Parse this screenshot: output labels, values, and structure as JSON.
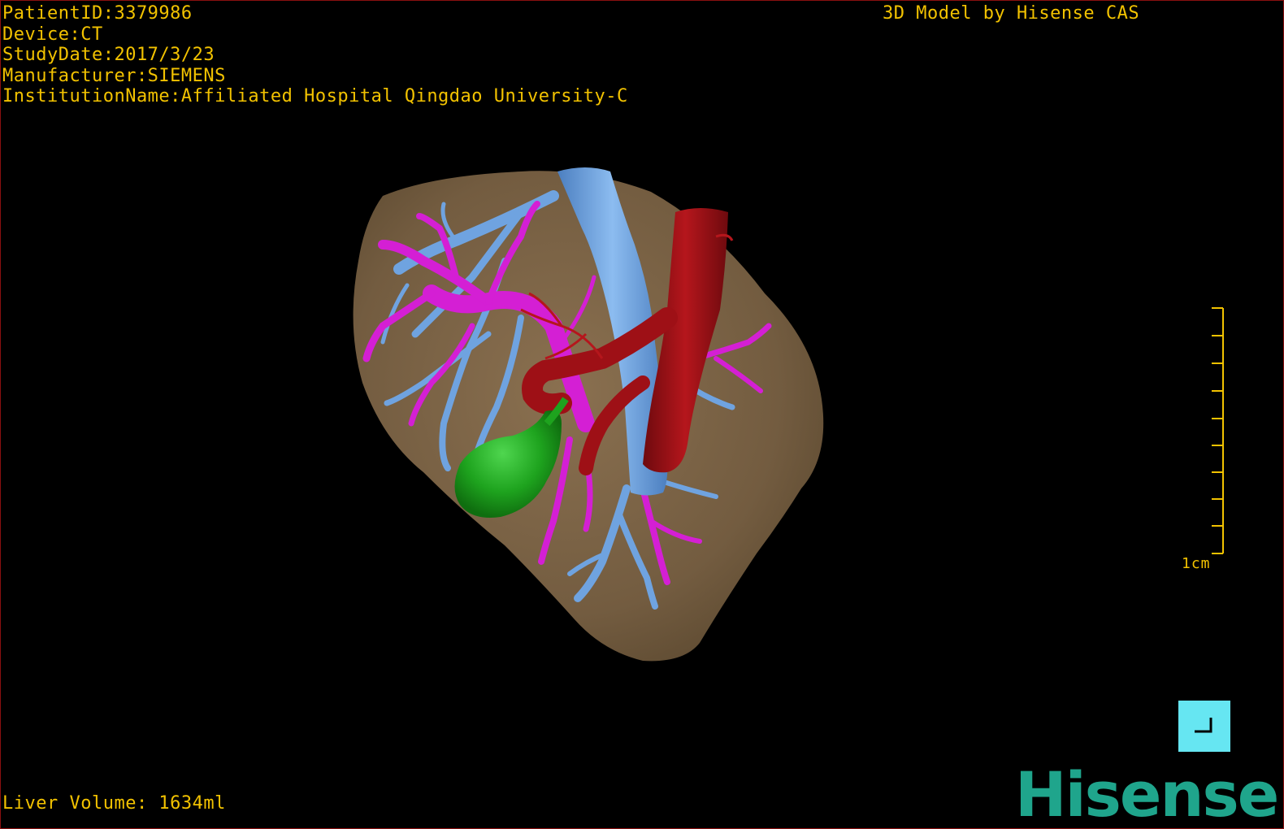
{
  "overlay": {
    "patient_id": "PatientID:3379986",
    "device": "Device:CT",
    "study_date": "StudyDate:2017/3/23",
    "manufacturer": "Manufacturer:SIEMENS",
    "institution": "InstitutionName:Affiliated Hospital Qingdao University-C",
    "credit": "3D Model by Hisense CAS",
    "liver_volume": "Liver Volume: 1634ml"
  },
  "scale_bar": {
    "label": "1cm"
  },
  "logo": {
    "text": "Hisense"
  },
  "colors": {
    "overlay_text": "#f2c200",
    "liver": "#7a6346",
    "portal_vein": "#d41fd4",
    "hepatic_vein": "#6fa3e0",
    "aorta": "#9e1016",
    "gallbladder": "#1ea31e",
    "logo": "#1fa58c",
    "corner_button": "#66e6f2"
  },
  "icons": {
    "corner_button": "corner-bracket-icon"
  }
}
